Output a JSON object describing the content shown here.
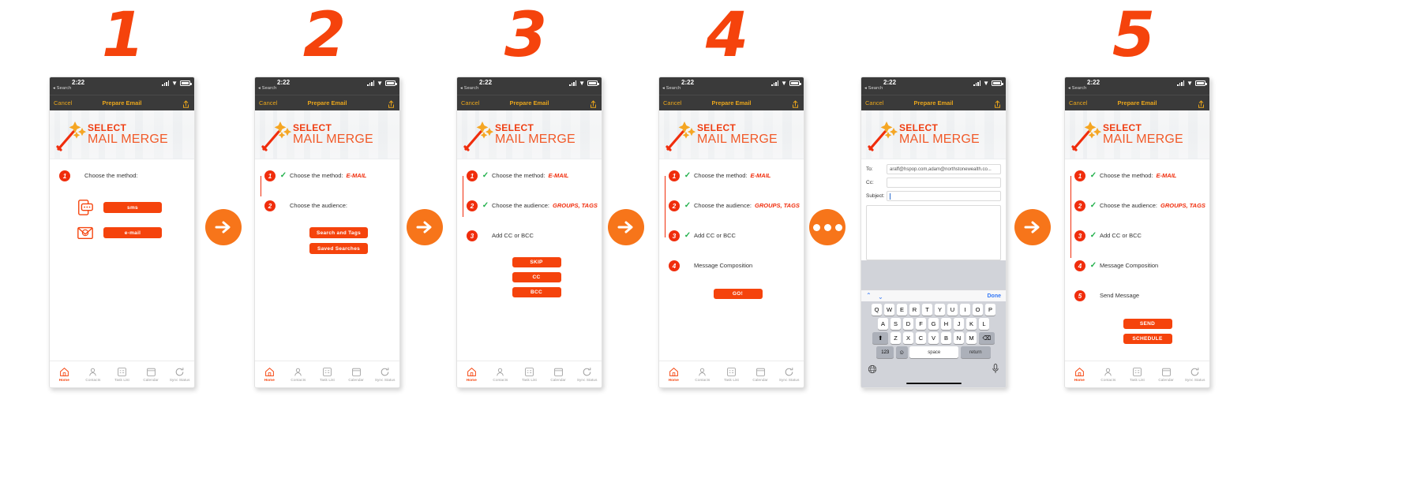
{
  "meta": {
    "accent": "#F5430C",
    "accent_light": "#F7751A",
    "check_green": "#22B14C",
    "nav_yellow": "#E8A51C"
  },
  "step_numerals": [
    "1",
    "2",
    "3",
    "4",
    "5"
  ],
  "connectors": [
    {
      "type": "arrow-icon"
    },
    {
      "type": "arrow-icon"
    },
    {
      "type": "arrow-icon"
    },
    {
      "type": "dots-icon"
    },
    {
      "type": "arrow-icon"
    }
  ],
  "status_bar": {
    "time": "2:22",
    "back_label": "Search"
  },
  "nav_bar": {
    "cancel": "Cancel",
    "title": "Prepare Email"
  },
  "banner": {
    "line1": "SELECT",
    "line2": "MAIL MERGE"
  },
  "tabbar": {
    "items": [
      {
        "label": "Home",
        "icon": "home-icon",
        "active": true
      },
      {
        "label": "Contacts",
        "icon": "contacts-icon",
        "active": false
      },
      {
        "label": "Task List",
        "icon": "task-list-icon",
        "active": false
      },
      {
        "label": "Calendar",
        "icon": "calendar-icon",
        "active": false
      },
      {
        "label": "Sync Status",
        "icon": "sync-icon",
        "active": false
      }
    ]
  },
  "screens": [
    {
      "id": "screen-1-choose-method",
      "steps": [
        {
          "num": "1",
          "checked": false,
          "text": "Choose the method:",
          "value": ""
        }
      ],
      "methods": [
        {
          "icon": "sms-phone-icon",
          "label": "sms"
        },
        {
          "icon": "email-envelope-icon",
          "label": "e-mail"
        }
      ],
      "buttons": []
    },
    {
      "id": "screen-2-choose-audience",
      "steps": [
        {
          "num": "1",
          "checked": true,
          "text": "Choose the method:",
          "value": "E-MAIL"
        },
        {
          "num": "2",
          "checked": false,
          "text": "Choose the audience:",
          "value": ""
        }
      ],
      "buttons": [
        "Search and Tags",
        "Saved Searches"
      ]
    },
    {
      "id": "screen-3-add-cc-bcc",
      "steps": [
        {
          "num": "1",
          "checked": true,
          "text": "Choose the method:",
          "value": "E-MAIL"
        },
        {
          "num": "2",
          "checked": true,
          "text": "Choose the audience:",
          "value": "GROUPS, TAGS"
        },
        {
          "num": "3",
          "checked": false,
          "text": "Add CC or BCC",
          "value": ""
        }
      ],
      "buttons": [
        "SKIP",
        "CC",
        "BCC"
      ]
    },
    {
      "id": "screen-4-message-composition",
      "steps": [
        {
          "num": "1",
          "checked": true,
          "text": "Choose the method:",
          "value": "E-MAIL"
        },
        {
          "num": "2",
          "checked": true,
          "text": "Choose the audience:",
          "value": "GROUPS, TAGS"
        },
        {
          "num": "3",
          "checked": true,
          "text": "Add CC or BCC",
          "value": ""
        },
        {
          "num": "4",
          "checked": false,
          "text": "Message Composition",
          "value": ""
        }
      ],
      "buttons": [
        "GO!"
      ]
    },
    {
      "id": "screen-6-send-message",
      "steps": [
        {
          "num": "1",
          "checked": true,
          "text": "Choose the method:",
          "value": "E-MAIL"
        },
        {
          "num": "2",
          "checked": true,
          "text": "Choose the audience:",
          "value": "GROUPS, TAGS"
        },
        {
          "num": "3",
          "checked": true,
          "text": "Add CC or BCC",
          "value": ""
        },
        {
          "num": "4",
          "checked": true,
          "text": "Message Composition",
          "value": ""
        },
        {
          "num": "5",
          "checked": false,
          "text": "Send Message",
          "value": ""
        }
      ],
      "buttons": [
        "SEND",
        "SCHEDULE"
      ]
    }
  ],
  "compose": {
    "id": "screen-5-compose",
    "to_label": "To:",
    "to_value": "araff@hspop.com,adam@northstonewealth.co...",
    "cc_label": "Cc:",
    "cc_value": "",
    "subject_label": "Subject:",
    "subject_value": "",
    "keyboard": {
      "done": "Done",
      "row1": [
        "Q",
        "W",
        "E",
        "R",
        "T",
        "Y",
        "U",
        "I",
        "O",
        "P"
      ],
      "row2": [
        "A",
        "S",
        "D",
        "F",
        "G",
        "H",
        "J",
        "K",
        "L"
      ],
      "row3": [
        "Z",
        "X",
        "C",
        "V",
        "B",
        "N",
        "M"
      ],
      "shift": "⬆",
      "delete": "⌫",
      "num_key": "123",
      "emoji_key": "☺",
      "space": "space",
      "return": "return",
      "globe": "globe-icon",
      "mic": "microphone-icon"
    }
  }
}
